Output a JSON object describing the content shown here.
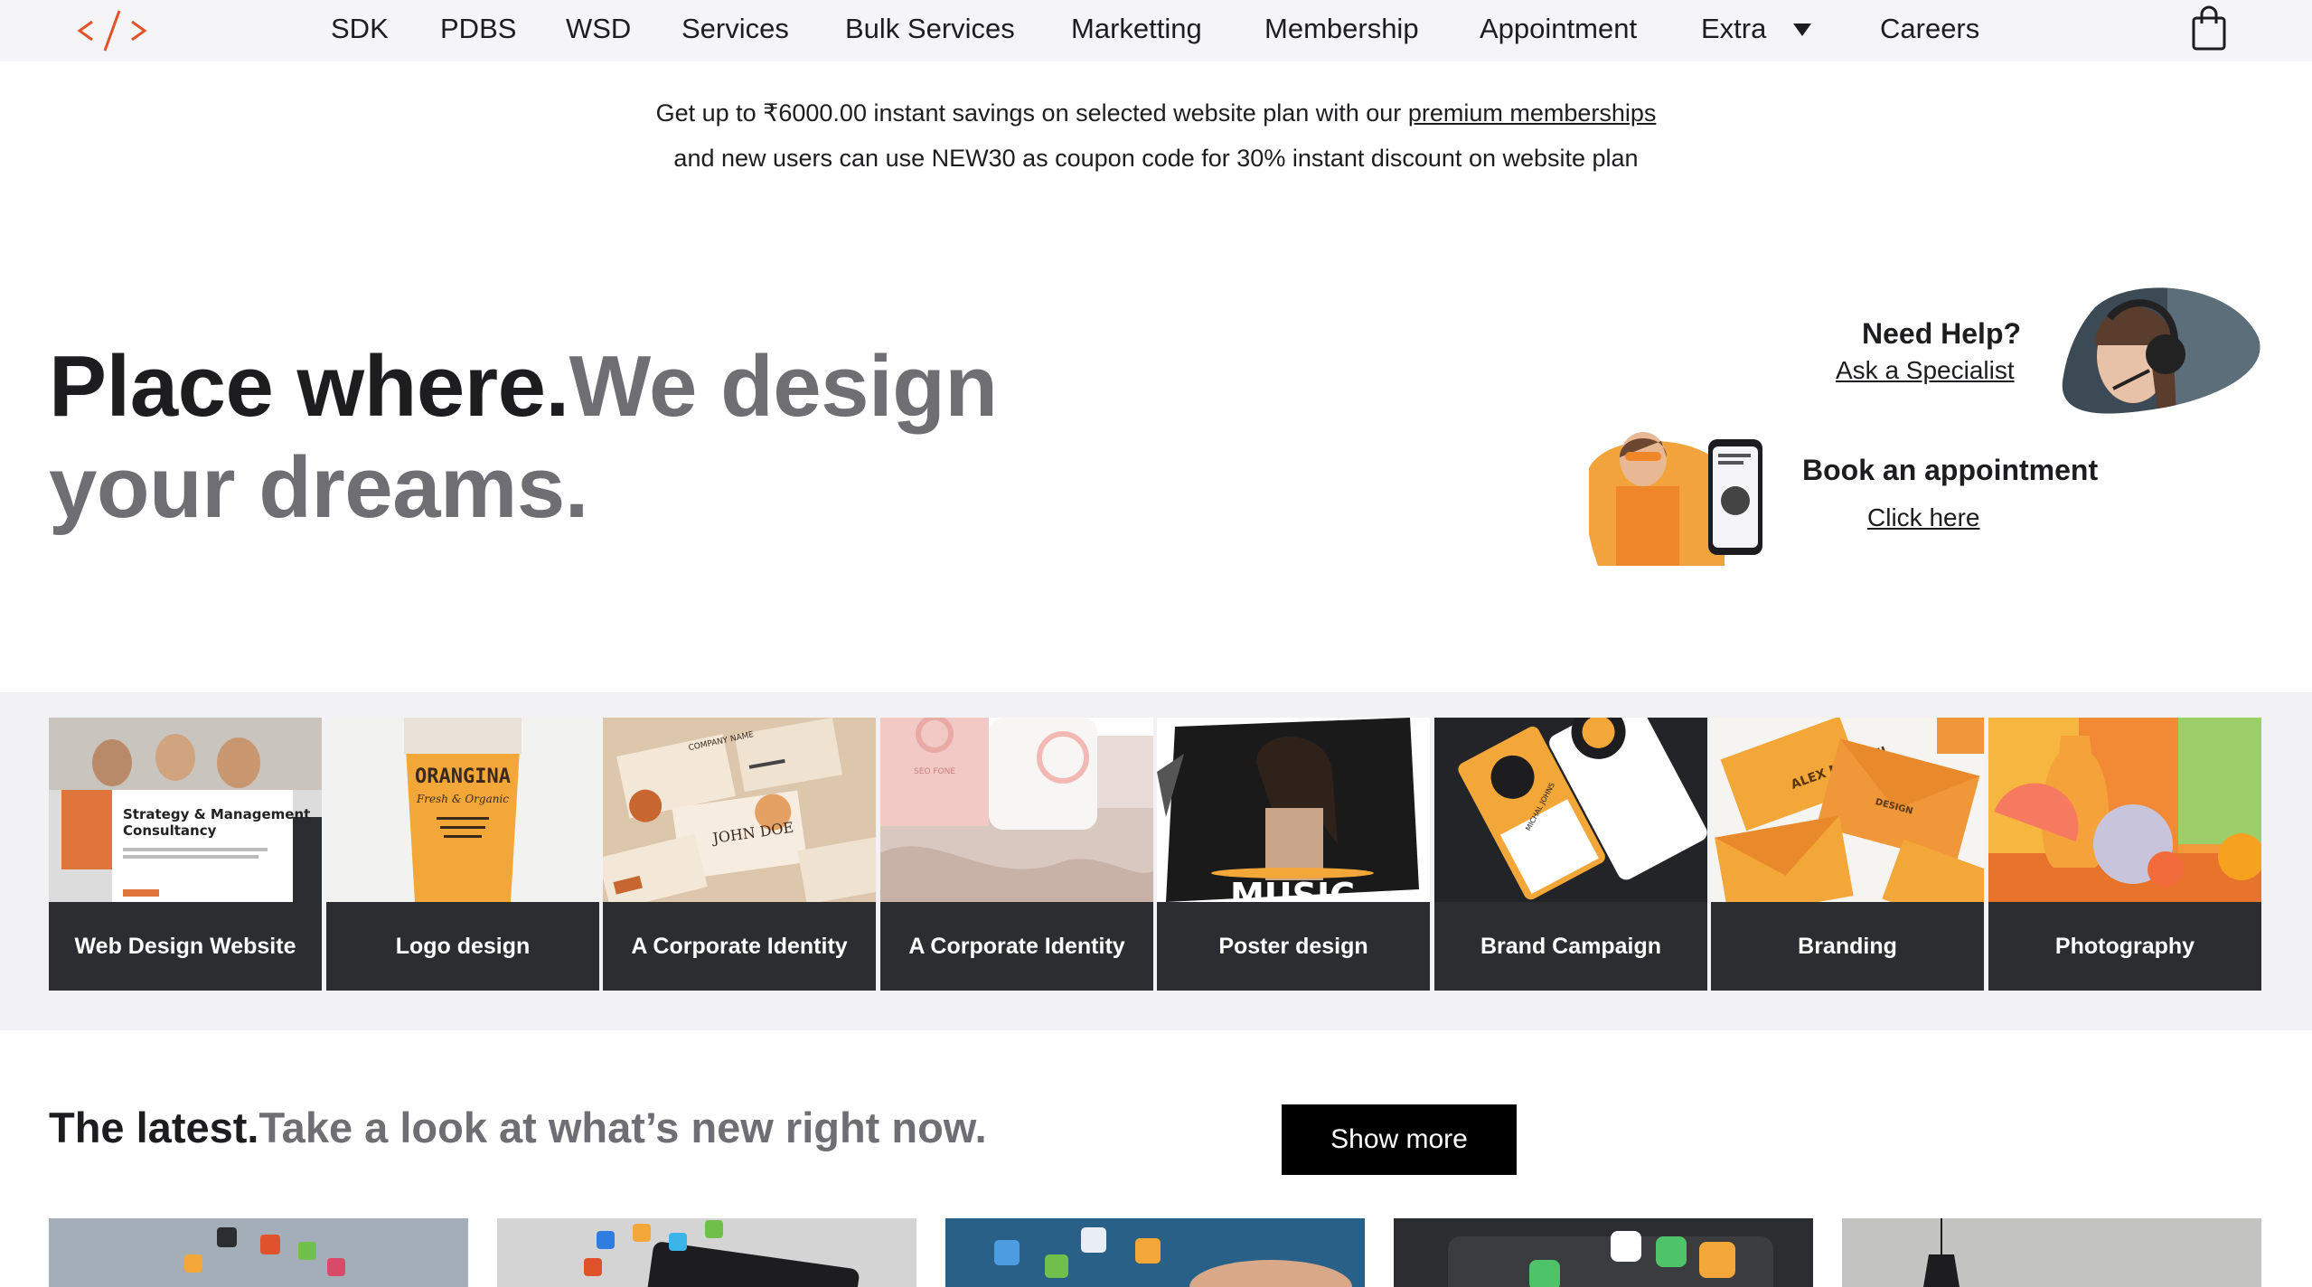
{
  "nav": {
    "items": [
      "SDK",
      "PDBS",
      "WSD",
      "Services",
      "Bulk Services",
      "Marketting",
      "Membership",
      "Appointment",
      "Extra",
      "Careers"
    ]
  },
  "promo": {
    "line1_prefix": "Get up to ₹6000.00 instant savings on selected website  plan with our ",
    "line1_link": "premium memberships",
    "line2": "and new users can use NEW30 as coupon code for 30% instant discount on website plan"
  },
  "hero": {
    "title_dark": "Place where.",
    "title_grey": "We design your dreams."
  },
  "help": {
    "title": "Need Help?",
    "link": "Ask a Specialist"
  },
  "appointment": {
    "title": "Book an appointment",
    "link": "Click here"
  },
  "categories": [
    {
      "label": "Web Design Website",
      "image_text": [
        "Strategy & Management",
        "Consultancy"
      ]
    },
    {
      "label": "Logo design",
      "image_text": [
        "ORANGINA",
        "Fresh & Organic"
      ]
    },
    {
      "label": "A Corporate Identity",
      "image_text": [
        "JOHN DOE",
        "COMPANY NAME"
      ]
    },
    {
      "label": "A Corporate Identity",
      "image_text": [
        "SEO FONE"
      ]
    },
    {
      "label": "Poster design",
      "image_text": [
        "MUSIC"
      ]
    },
    {
      "label": "Brand Campaign",
      "image_text": [
        "MICHAL JOHNS"
      ]
    },
    {
      "label": "Branding",
      "image_text": [
        "ALEX MICHAEL",
        "DESIGN"
      ]
    },
    {
      "label": "Photography",
      "image_text": []
    }
  ],
  "latest": {
    "title_dark": "The latest.",
    "title_grey": "Take a look at what’s new right now.",
    "button": "Show more"
  },
  "colors": {
    "nav_bg": "#f5f5f7",
    "accent_orange": "#f0862a",
    "card_bg": "#2b2d30",
    "strip_bg": "#f2f2f4",
    "text_grey": "#6e6e73"
  },
  "icons": [
    "code-logo-icon",
    "caret-down-icon",
    "shopping-bag-icon"
  ]
}
